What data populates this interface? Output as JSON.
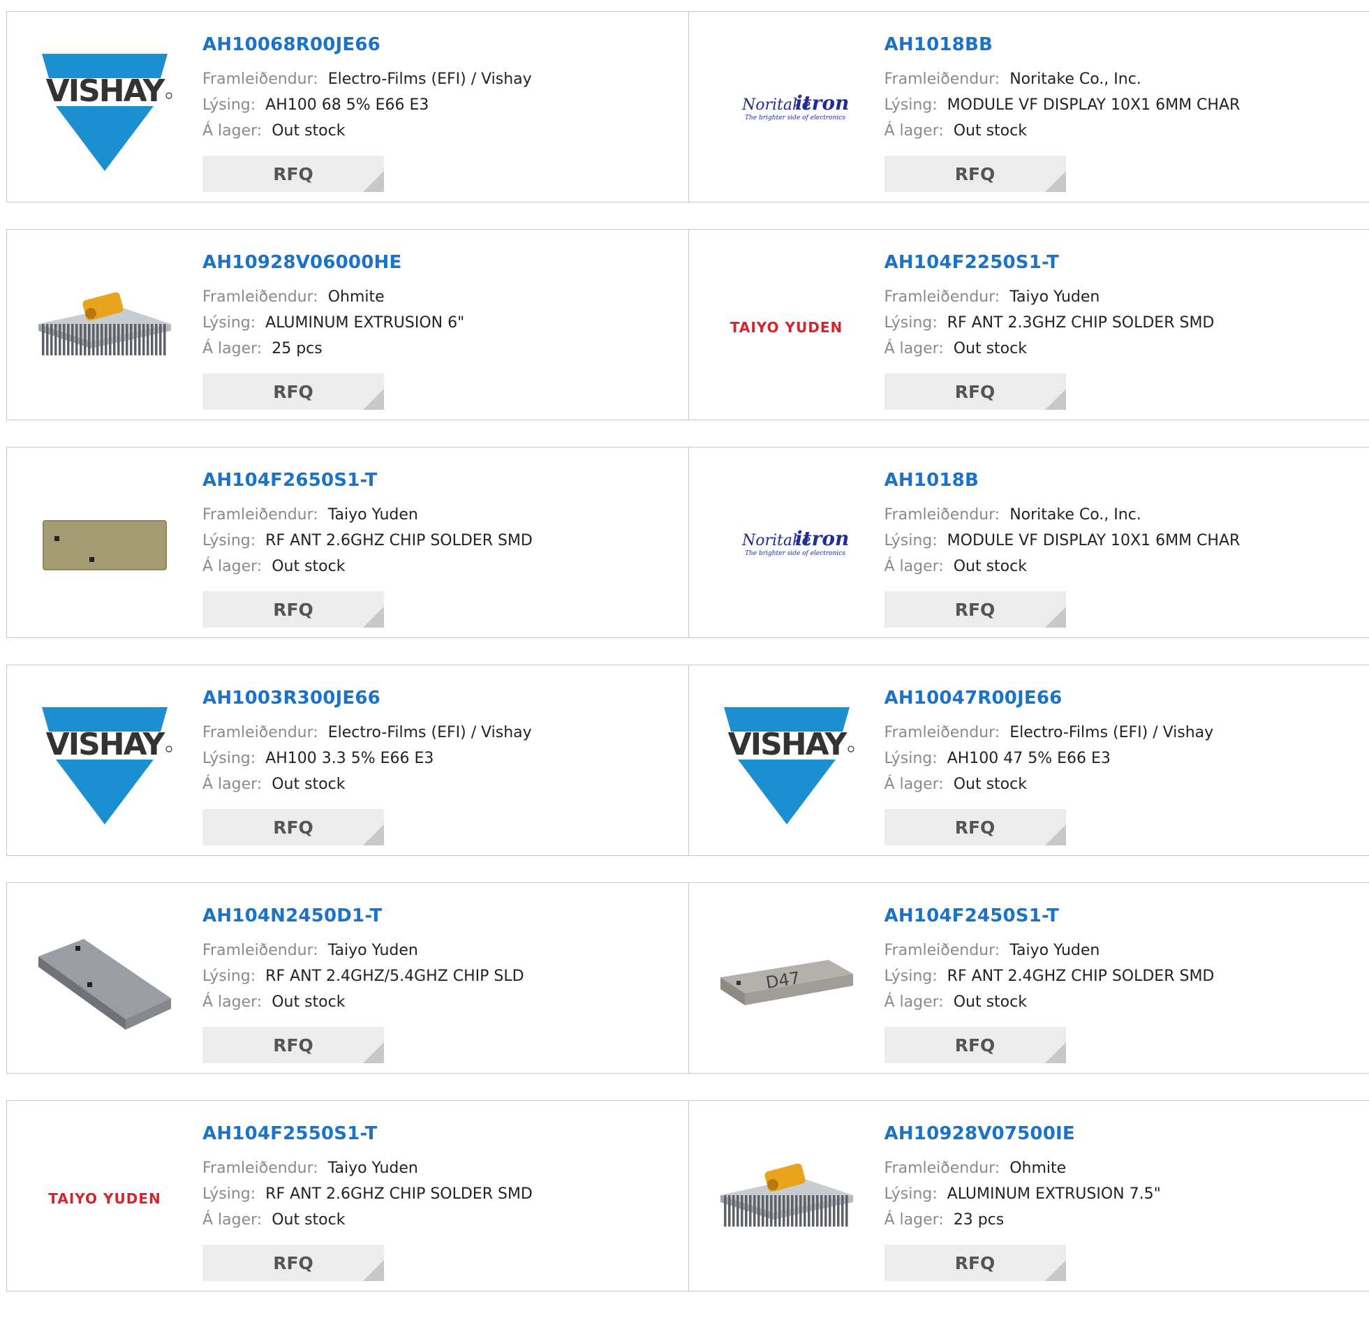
{
  "labels": {
    "manufacturer": "Framleiðendur:",
    "description": "Lýsing:",
    "stock": "Á lager:",
    "rfq": "RFQ"
  },
  "logo_text": {
    "vishay": "VISHAY",
    "noritake": "Noritake",
    "itron": "itron",
    "noritake_tag": "The brighter side of electronics",
    "taiyo": "TAIYO YUDEN"
  },
  "products": [
    {
      "part": "AH10068R00JE66",
      "manufacturer": "Electro-Films (EFI) / Vishay",
      "description": "AH100 68 5% E66 E3",
      "stock": "Out stock",
      "image": "vishay-logo"
    },
    {
      "part": "AH1018BB",
      "manufacturer": "Noritake Co., Inc.",
      "description": "MODULE VF DISPLAY 10X1 6MM CHAR",
      "stock": "Out stock",
      "image": "noritake-logo"
    },
    {
      "part": "AH10928V06000HE",
      "manufacturer": "Ohmite",
      "description": "ALUMINUM EXTRUSION 6\"",
      "stock": "25 pcs",
      "image": "heatsink-photo"
    },
    {
      "part": "AH104F2250S1-T",
      "manufacturer": "Taiyo Yuden",
      "description": "RF ANT 2.3GHZ CHIP SOLDER SMD",
      "stock": "Out stock",
      "image": "taiyo-logo"
    },
    {
      "part": "AH104F2650S1-T",
      "manufacturer": "Taiyo Yuden",
      "description": "RF ANT 2.6GHZ CHIP SOLDER SMD",
      "stock": "Out stock",
      "image": "chip-flat-photo"
    },
    {
      "part": "AH1018B",
      "manufacturer": "Noritake Co., Inc.",
      "description": "MODULE VF DISPLAY 10X1 6MM CHAR",
      "stock": "Out stock",
      "image": "noritake-logo"
    },
    {
      "part": "AH1003R300JE66",
      "manufacturer": "Electro-Films (EFI) / Vishay",
      "description": "AH100 3.3 5% E66 E3",
      "stock": "Out stock",
      "image": "vishay-logo"
    },
    {
      "part": "AH10047R00JE66",
      "manufacturer": "Electro-Films (EFI) / Vishay",
      "description": "AH100 47 5% E66 E3",
      "stock": "Out stock",
      "image": "vishay-logo"
    },
    {
      "part": "AH104N2450D1-T",
      "manufacturer": "Taiyo Yuden",
      "description": "RF ANT 2.4GHZ/5.4GHZ CHIP SLD",
      "stock": "Out stock",
      "image": "chip-angled-photo"
    },
    {
      "part": "AH104F2450S1-T",
      "manufacturer": "Taiyo Yuden",
      "description": "RF ANT 2.4GHZ CHIP SOLDER SMD",
      "stock": "Out stock",
      "image": "chip-d47-photo",
      "chip_marking": "D47"
    },
    {
      "part": "AH104F2550S1-T",
      "manufacturer": "Taiyo Yuden",
      "description": "RF ANT 2.6GHZ CHIP SOLDER SMD",
      "stock": "Out stock",
      "image": "taiyo-logo"
    },
    {
      "part": "AH10928V07500IE",
      "manufacturer": "Ohmite",
      "description": "ALUMINUM EXTRUSION 7.5\"",
      "stock": "23 pcs",
      "image": "heatsink-photo"
    }
  ],
  "colors": {
    "link": "#1a73c9",
    "vishay_blue": "#1b8fd0",
    "taiyo_red": "#d8232a",
    "rfq_bg": "#ececec"
  }
}
